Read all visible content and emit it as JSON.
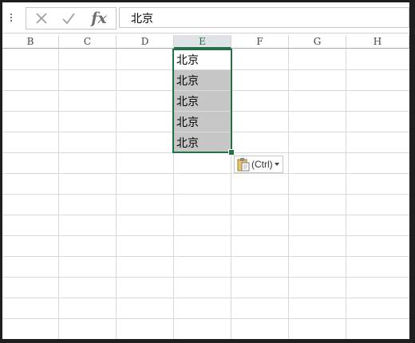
{
  "formula_bar": {
    "name_box_icons": [
      "cancel-icon",
      "enter-icon",
      "fx-icon"
    ],
    "fx_label": "fx",
    "content": "北京"
  },
  "columns": [
    {
      "label": "B",
      "selected": false
    },
    {
      "label": "C",
      "selected": false
    },
    {
      "label": "D",
      "selected": false
    },
    {
      "label": "E",
      "selected": true
    },
    {
      "label": "F",
      "selected": false
    },
    {
      "label": "G",
      "selected": false
    },
    {
      "label": "H",
      "selected": false
    }
  ],
  "cells": {
    "e1": "北京",
    "e2": "北京",
    "e3": "北京",
    "e4": "北京",
    "e5": "北京"
  },
  "paste_options": {
    "label": "(Ctrl)",
    "icon": "clipboard-icon"
  },
  "colors": {
    "selection_border": "#217346",
    "selected_fill": "#c6c6c6",
    "grid_line": "#d9d9d9"
  }
}
